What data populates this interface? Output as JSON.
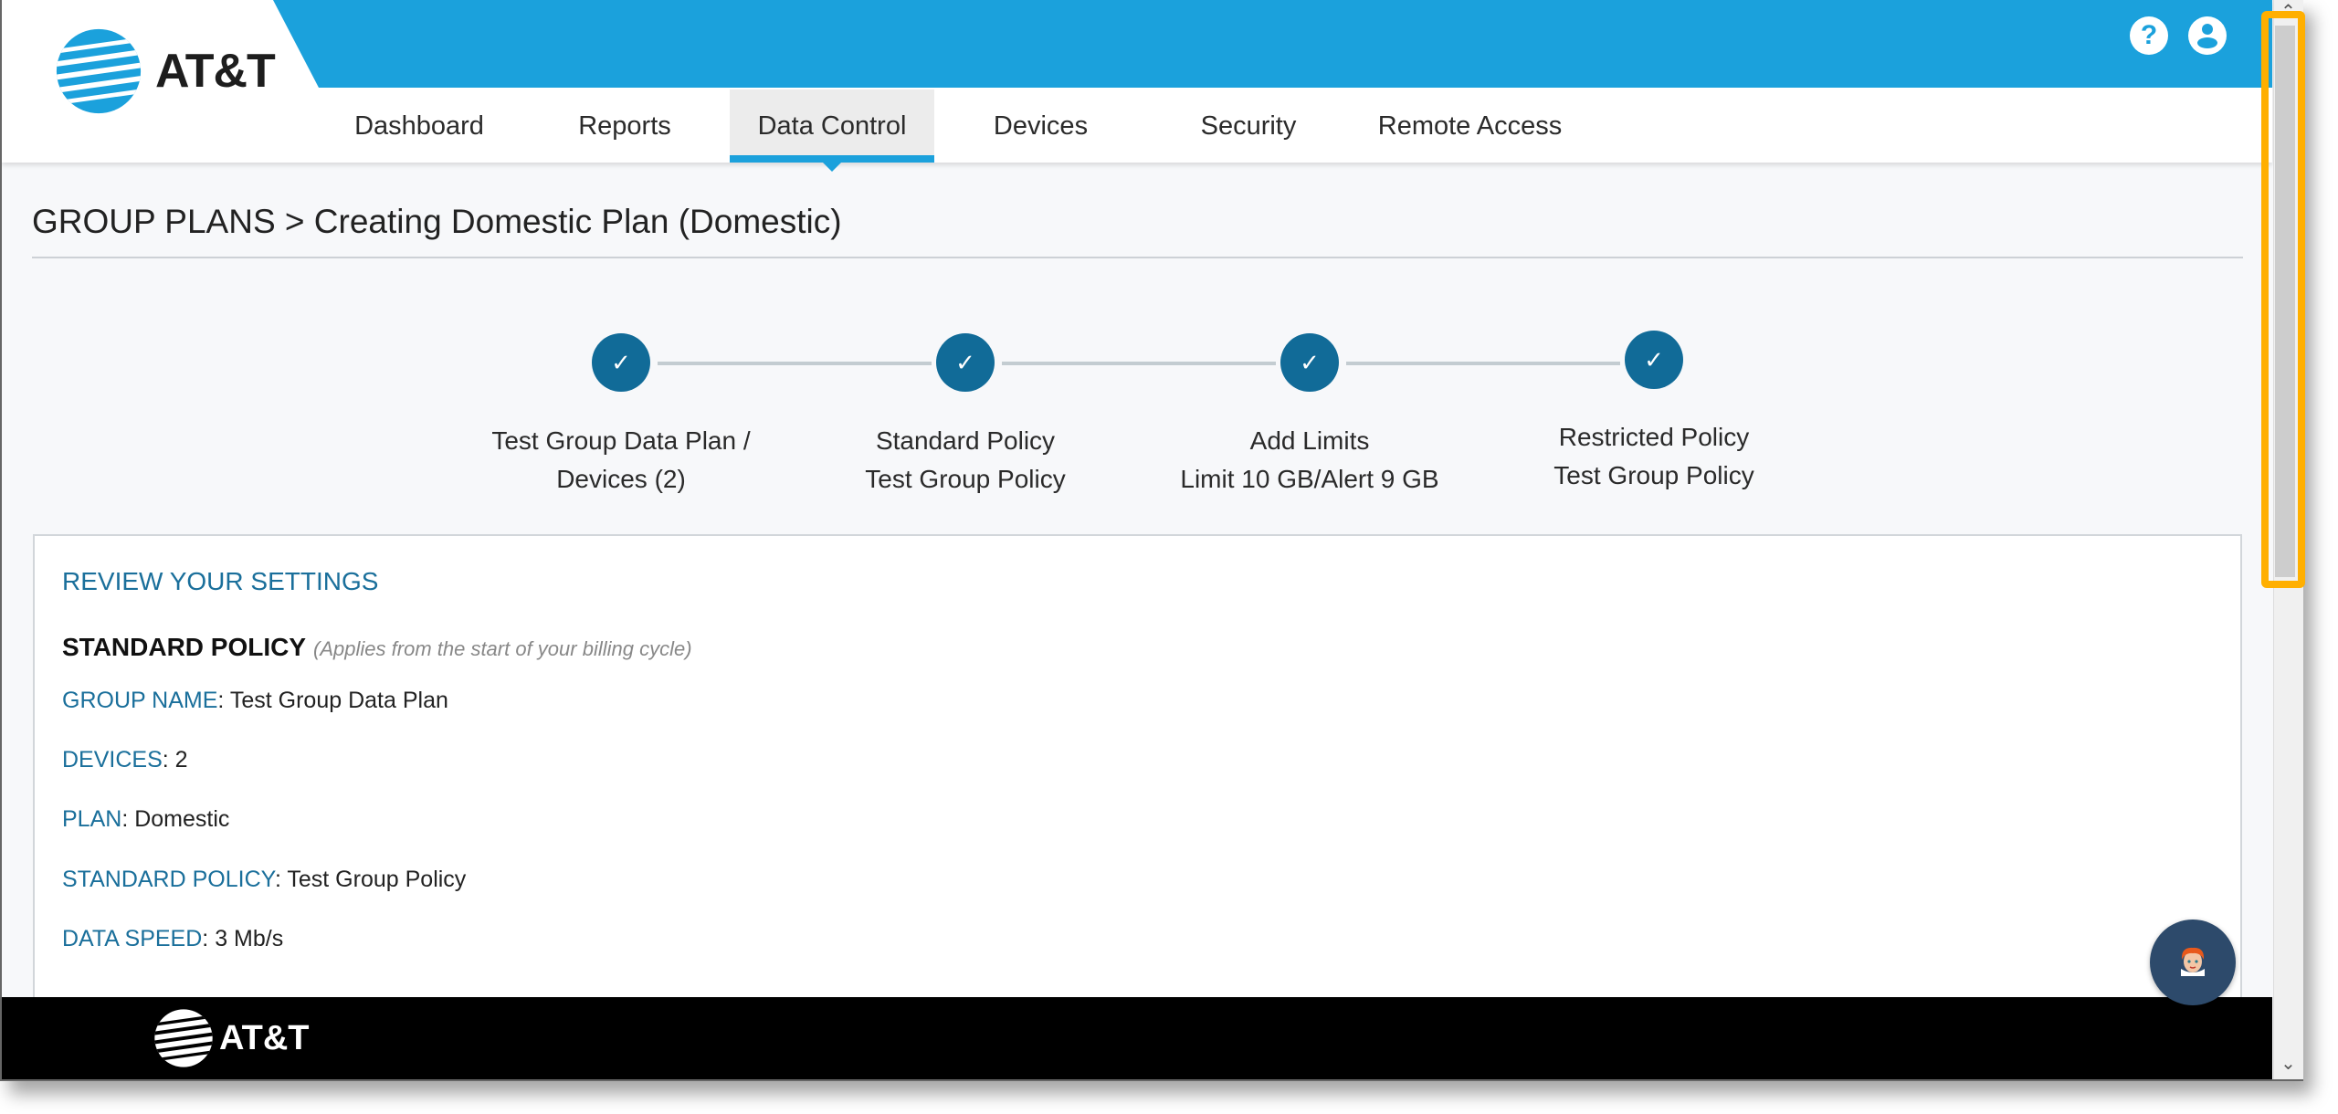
{
  "brand": {
    "name": "AT&T",
    "primary_color": "#1ba1dc",
    "step_color": "#116b98",
    "label_color": "#1a6f9b"
  },
  "header": {
    "icons": [
      {
        "name": "help-icon",
        "glyph": "?"
      },
      {
        "name": "user-account-icon",
        "glyph": ""
      }
    ]
  },
  "nav": {
    "items": [
      {
        "label": "Dashboard",
        "active": false
      },
      {
        "label": "Reports",
        "active": false
      },
      {
        "label": "Data Control",
        "active": true
      },
      {
        "label": "Devices",
        "active": false
      },
      {
        "label": "Security",
        "active": false
      },
      {
        "label": "Remote Access",
        "active": false
      }
    ]
  },
  "breadcrumb": "GROUP PLANS > Creating Domestic Plan (Domestic)",
  "steps": [
    {
      "line1": "Test Group Data Plan /",
      "line2": "Devices (2)",
      "status": "complete",
      "icon": "✓"
    },
    {
      "line1": "Standard Policy",
      "line2": "Test Group Policy",
      "status": "complete",
      "icon": "✓"
    },
    {
      "line1": "Add Limits",
      "line2": "Limit 10 GB/Alert 9 GB",
      "status": "complete",
      "icon": "✓"
    },
    {
      "line1": "Restricted Policy",
      "line2": "Test Group Policy",
      "status": "complete",
      "icon": "✓"
    }
  ],
  "review": {
    "title": "REVIEW YOUR SETTINGS",
    "policy_title": "STANDARD POLICY",
    "policy_note": "(Applies from the start of your billing cycle)",
    "fields": [
      {
        "key": "GROUP NAME",
        "value": "Test Group Data Plan"
      },
      {
        "key": "DEVICES",
        "value": "2"
      },
      {
        "key": "PLAN",
        "value": "Domestic"
      },
      {
        "key": "STANDARD POLICY",
        "value": "Test Group Policy"
      },
      {
        "key": "DATA SPEED",
        "value": "3 Mb/s"
      }
    ]
  },
  "footer": {
    "brand": "AT&T"
  },
  "scrollbar": {
    "up": "⌃",
    "down": "⌄"
  }
}
